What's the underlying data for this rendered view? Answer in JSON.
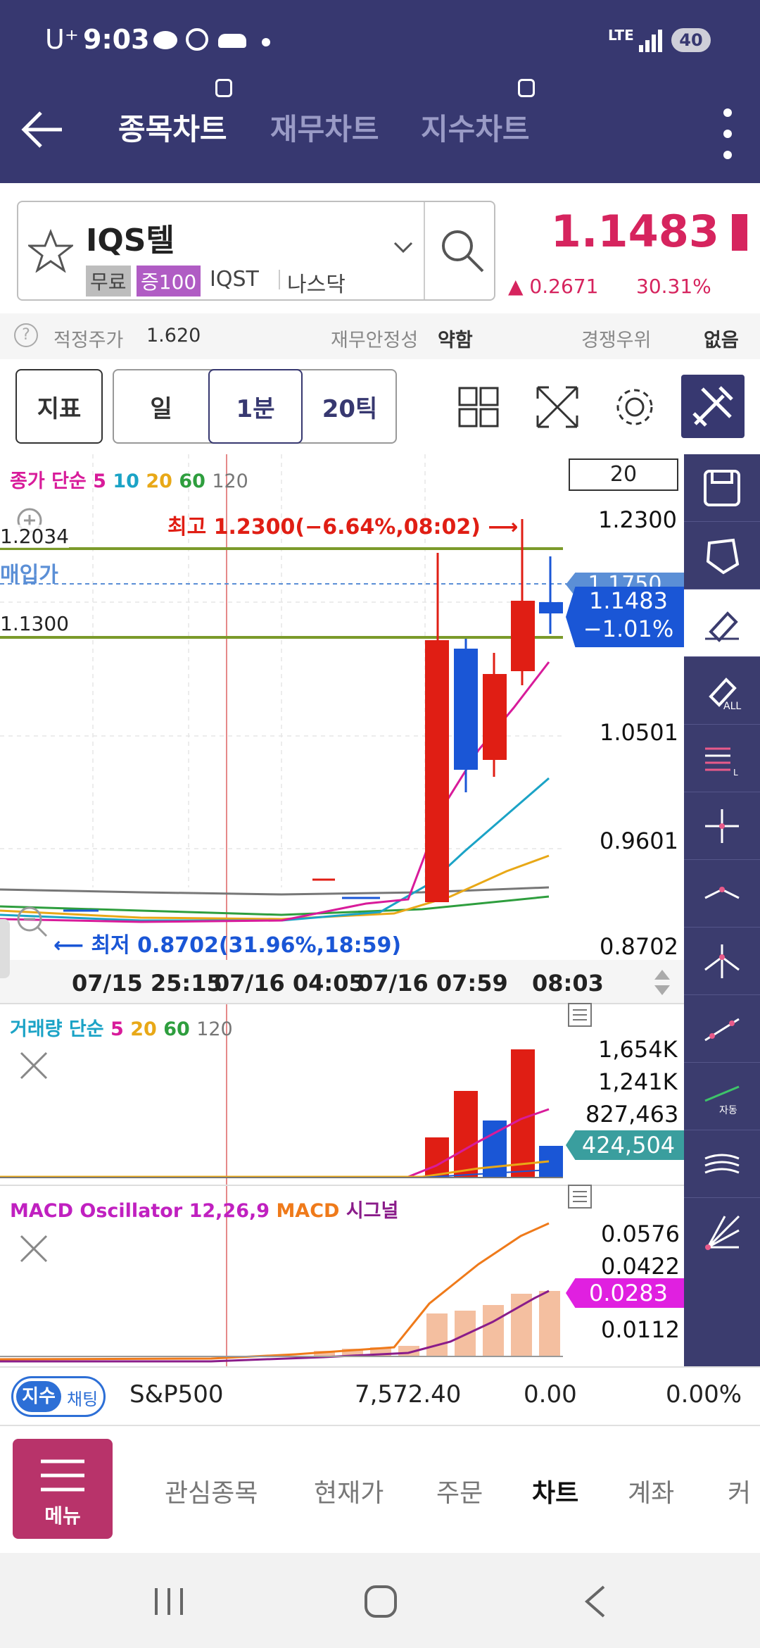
{
  "status": {
    "carrier": "U⁺",
    "time": "9:03",
    "network": "LTE",
    "battery": "40"
  },
  "tabs": [
    {
      "label": "종목차트",
      "active": true
    },
    {
      "label": "재무차트",
      "active": false
    },
    {
      "label": "지수차트",
      "active": false
    }
  ],
  "stock": {
    "name": "IQS텔",
    "badge_free": "무료",
    "badge_margin": "증100",
    "ticker": "IQST",
    "market": "나스닥",
    "price": "1.1483",
    "change": "▲ 0.2671",
    "change_pct": "30.31%"
  },
  "info": {
    "fair_label": "적정주가",
    "fair_value": "1.620",
    "stability_label": "재무안정성",
    "stability_value": "약함",
    "competitive_label": "경쟁우위",
    "competitive_value": "없음"
  },
  "toolbar": {
    "indicator": "지표",
    "day": "일",
    "minute": "1분",
    "tick": "20틱"
  },
  "chart": {
    "ma_legend": {
      "prefix": "종가 단순",
      "p5": "5",
      "p10": "10",
      "p20": "20",
      "p60": "60",
      "p120": "120"
    },
    "count_box": "20",
    "high_annotation": "최고 1.2300(−6.64%,08:02) ⟶",
    "low_annotation": "⟵ 최저 0.8702(31.96%,18:59)",
    "line_upper": "1.2034",
    "buy_price_label": "매입가",
    "line_lower": "1.1300",
    "axis_top": "1.2300",
    "buy_tag": "1.1750",
    "current_tag_price": "1.1483",
    "current_tag_pct": "−1.01%",
    "axis_mid1": "1.0501",
    "axis_mid2": "0.9601",
    "axis_bottom": "0.8702",
    "time_labels": [
      "07/15 25:15",
      "07/16 04:05",
      "07/16 07:59",
      "08:03"
    ],
    "colors": {
      "up": "#e01e14",
      "down": "#1a56d6",
      "ma5": "#d81b9a",
      "ma10": "#1ba3c6",
      "ma20": "#e8a817",
      "ma60": "#2e9e3e",
      "ma120": "#777777"
    }
  },
  "volume": {
    "legend_prefix": "거래량 단순",
    "p5": "5",
    "p20": "20",
    "p60": "60",
    "p120": "120",
    "axis": [
      "1,654K",
      "1,241K",
      "827,463"
    ],
    "tag": "424,504"
  },
  "macd": {
    "legend_osc": "MACD Oscillator 12,26,9",
    "legend_macd": "MACD",
    "legend_signal": "시그널",
    "axis": [
      "0.0576",
      "0.0422",
      "0.0112"
    ],
    "tag": "0.0283"
  },
  "indexbar": {
    "badge1": "지수",
    "badge2": "채팅",
    "name": "S&P500",
    "value": "7,572.40",
    "change": "0.00",
    "pct": "0.00%"
  },
  "menu": {
    "menu_label": "메뉴",
    "items": [
      "관심종목",
      "현재가",
      "주문",
      "차트",
      "계좌",
      "커"
    ]
  }
}
